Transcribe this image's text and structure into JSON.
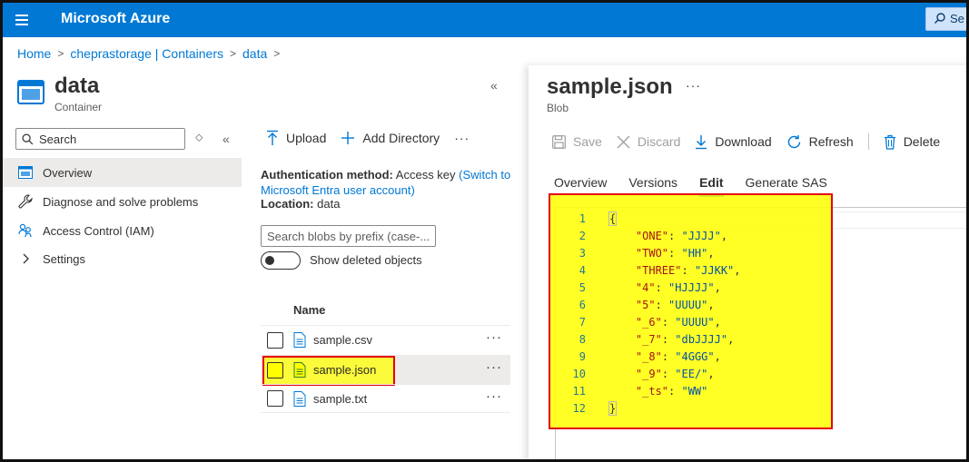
{
  "topbar": {
    "brand": "Microsoft Azure",
    "search_label": "Se"
  },
  "breadcrumb": [
    "Home",
    "cheprastorage | Containers",
    "data"
  ],
  "resource": {
    "title": "data",
    "subtitle": "Container"
  },
  "nav": {
    "search_placeholder": "Search",
    "items": [
      {
        "label": "Overview",
        "icon": "overview-icon",
        "active": true
      },
      {
        "label": "Diagnose and solve problems",
        "icon": "wrench-icon"
      },
      {
        "label": "Access Control (IAM)",
        "icon": "people-icon"
      },
      {
        "label": "Settings",
        "icon": "chevron-right-icon"
      }
    ]
  },
  "container": {
    "toolbar": {
      "upload": "Upload",
      "add_directory": "Add Directory",
      "more": "···"
    },
    "auth_label": "Authentication method:",
    "auth_value": "Access key",
    "auth_link": "(Switch to Microsoft Entra user account)",
    "location_label": "Location:",
    "location_value": "data",
    "blob_search_placeholder": "Search blobs by prefix (case-...",
    "show_deleted": "Show deleted objects",
    "column_name": "Name",
    "blobs": [
      {
        "name": "sample.csv",
        "selected": false
      },
      {
        "name": "sample.json",
        "selected": true
      },
      {
        "name": "sample.txt",
        "selected": false
      }
    ]
  },
  "blob": {
    "title": "sample.json",
    "subtitle": "Blob",
    "toolbar": {
      "save": "Save",
      "discard": "Discard",
      "download": "Download",
      "refresh": "Refresh",
      "delete": "Delete"
    },
    "tabs": [
      "Overview",
      "Versions",
      "Edit",
      "Generate SAS"
    ],
    "active_tab": "Edit",
    "line_numbers": [
      "1",
      "2",
      "3",
      "4",
      "5",
      "6",
      "7",
      "8",
      "9",
      "10",
      "11",
      "12"
    ],
    "json_entries": [
      {
        "key": "\"ONE\"",
        "value": "\"JJJJ\"",
        "comma": ","
      },
      {
        "key": "\"TWO\"",
        "value": "\"HH\"",
        "comma": ","
      },
      {
        "key": "\"THREE\"",
        "value": "\"JJKK\"",
        "comma": ","
      },
      {
        "key": "\"4\"",
        "value": "\"HJJJJ\"",
        "comma": ","
      },
      {
        "key": "\"5\"",
        "value": "\"UUUU\"",
        "comma": ","
      },
      {
        "key": "\"_6\"",
        "value": "\"UUUU\"",
        "comma": ","
      },
      {
        "key": "\"_7\"",
        "value": "\"dbJJJJ\"",
        "comma": ","
      },
      {
        "key": "\"_8\"",
        "value": "\"4GGG\"",
        "comma": ","
      },
      {
        "key": "\"_9\"",
        "value": "\"EE/\"",
        "comma": ","
      },
      {
        "key": "\"_ts\"",
        "value": "\"WW\"",
        "comma": ""
      }
    ],
    "open_brace": "{",
    "close_brace": "}"
  },
  "colors": {
    "azure_blue": "#0078d4",
    "highlight_yellow": "#ffff00",
    "annotation_red": "#e3000f"
  }
}
